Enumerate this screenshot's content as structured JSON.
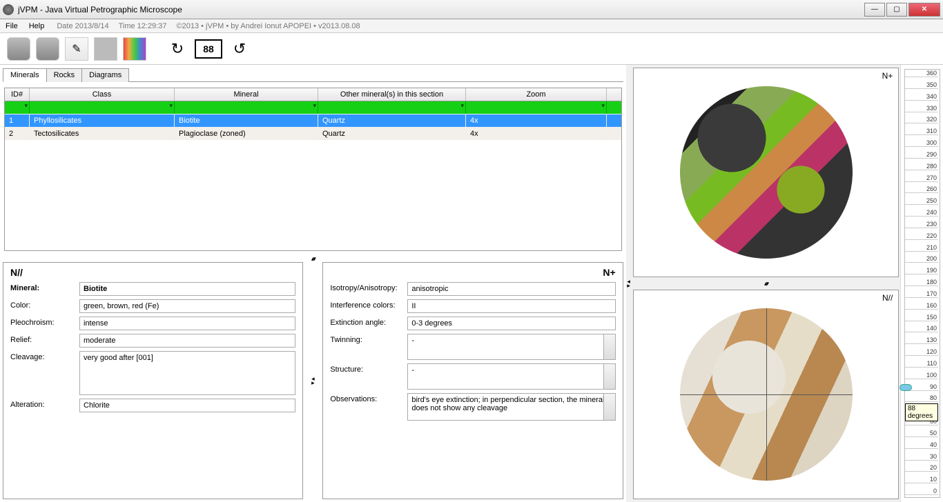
{
  "window": {
    "title": "jVPM - Java Virtual Petrographic Microscope"
  },
  "menu": {
    "file": "File",
    "help": "Help"
  },
  "status": {
    "date": "Date 2013/8/14",
    "time": "Time 12:29:37",
    "copyright": "©2013 • jVPM • by Andrei Ionut APOPEI • v2013.08.08"
  },
  "toolbar": {
    "angle": "88"
  },
  "tabs": {
    "minerals": "Minerals",
    "rocks": "Rocks",
    "diagrams": "Diagrams"
  },
  "table": {
    "headers": {
      "id": "ID#",
      "class": "Class",
      "mineral": "Mineral",
      "other": "Other mineral(s) in this section",
      "zoom": "Zoom"
    },
    "rows": [
      {
        "id": "1",
        "class": "Phyllosilicates",
        "mineral": "Biotite",
        "other": "Quartz",
        "zoom": "4x"
      },
      {
        "id": "2",
        "class": "Tectosilicates",
        "mineral": "Plagioclase (zoned)",
        "other": "Quartz",
        "zoom": "4x"
      }
    ]
  },
  "panel_npar": {
    "title": "N//",
    "labels": {
      "mineral": "Mineral:",
      "color": "Color:",
      "pleo": "Pleochroism:",
      "relief": "Relief:",
      "cleavage": "Cleavage:",
      "alteration": "Alteration:"
    },
    "values": {
      "mineral": "Biotite",
      "color": "green, brown, red (Fe)",
      "pleo": "intense",
      "relief": "moderate",
      "cleavage": "very good after [001]",
      "alteration": "Chlorite"
    }
  },
  "panel_ncross": {
    "title": "N+",
    "labels": {
      "iso": "Isotropy/Anisotropy:",
      "intcol": "Interference colors:",
      "ext": "Extinction angle:",
      "twin": "Twinning:",
      "struct": "Structure:",
      "obs": "Observations:"
    },
    "values": {
      "iso": "anisotropic",
      "intcol": "II",
      "ext": "0-3 degrees",
      "twin": "-",
      "struct": "-",
      "obs": "bird's eye extinction; in perpendicular section, the mineral does not show any cleavage"
    }
  },
  "viewer": {
    "top_label": "N+",
    "bottom_label": "N//"
  },
  "ruler": {
    "tooltip": "88 degrees",
    "thumb_value": 88
  }
}
